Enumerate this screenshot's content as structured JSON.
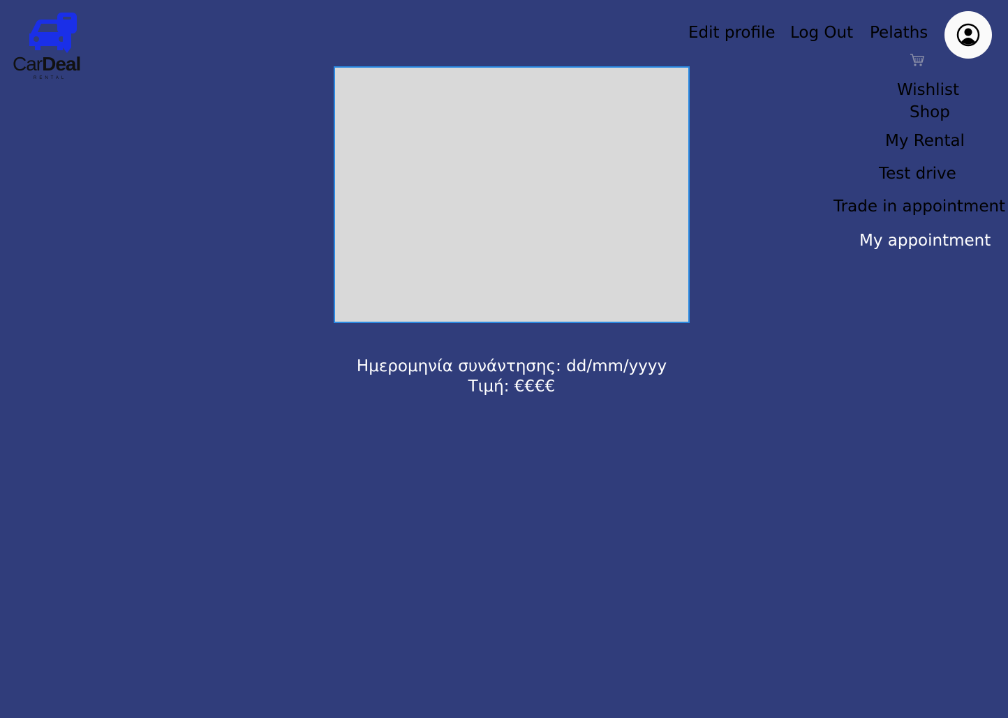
{
  "brand": {
    "name_part1": "Car",
    "name_part2": "Deal",
    "tagline": "RENTAL",
    "brand_color": "#1a2fe8"
  },
  "header": {
    "edit_profile": "Edit profile",
    "log_out": "Log Out",
    "user_name": "Pelaths"
  },
  "icons": {
    "avatar": "user-circle-icon",
    "cart": "shopping-cart-icon"
  },
  "menu": {
    "wishlist": "Wishlist",
    "shop": "Shop",
    "my_rental": "My Rental",
    "test_drive": "Test drive",
    "trade_in": "Trade in appointment",
    "my_appointment": "My appointment"
  },
  "appointment": {
    "date_line": "Ημερομηνία συνάντησης: dd/mm/yyyy",
    "price_line": "Τιμή: €€€€"
  },
  "colors": {
    "background": "#303d7b",
    "image_placeholder": "#d9d9d9",
    "image_border": "#2b8ae2",
    "active_link": "#ffffff"
  }
}
